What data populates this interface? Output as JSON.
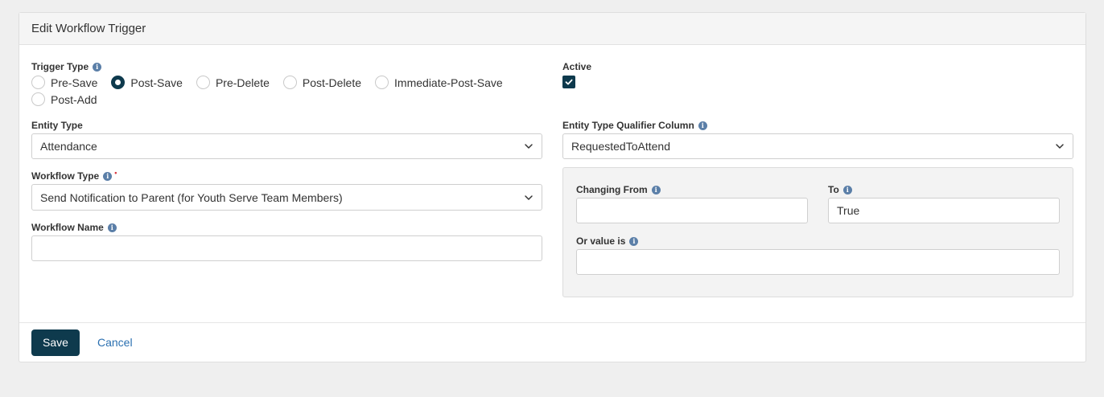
{
  "panel": {
    "title": "Edit Workflow Trigger"
  },
  "trigger_type": {
    "label": "Trigger Type",
    "options": [
      "Pre-Save",
      "Post-Save",
      "Pre-Delete",
      "Post-Delete",
      "Immediate-Post-Save",
      "Post-Add"
    ],
    "selected": "Post-Save"
  },
  "active": {
    "label": "Active",
    "checked": true
  },
  "entity_type": {
    "label": "Entity Type",
    "value": "Attendance"
  },
  "qualifier_column": {
    "label": "Entity Type Qualifier Column",
    "value": "RequestedToAttend"
  },
  "workflow_type": {
    "label": "Workflow Type",
    "required_marker": "•",
    "value": "Send Notification to Parent (for Youth Serve Team Members)"
  },
  "workflow_name": {
    "label": "Workflow Name",
    "value": ""
  },
  "qualifier": {
    "changing_from": {
      "label": "Changing From",
      "value": ""
    },
    "to": {
      "label": "To",
      "value": "True"
    },
    "or_value_is": {
      "label": "Or value is",
      "value": ""
    }
  },
  "footer": {
    "save_label": "Save",
    "cancel_label": "Cancel"
  },
  "colors": {
    "primary": "#0e3a4d",
    "link": "#2a6fb0",
    "info_icon": "#5b7fa8",
    "required": "#d9363e"
  },
  "info_icon_glyph": "i"
}
